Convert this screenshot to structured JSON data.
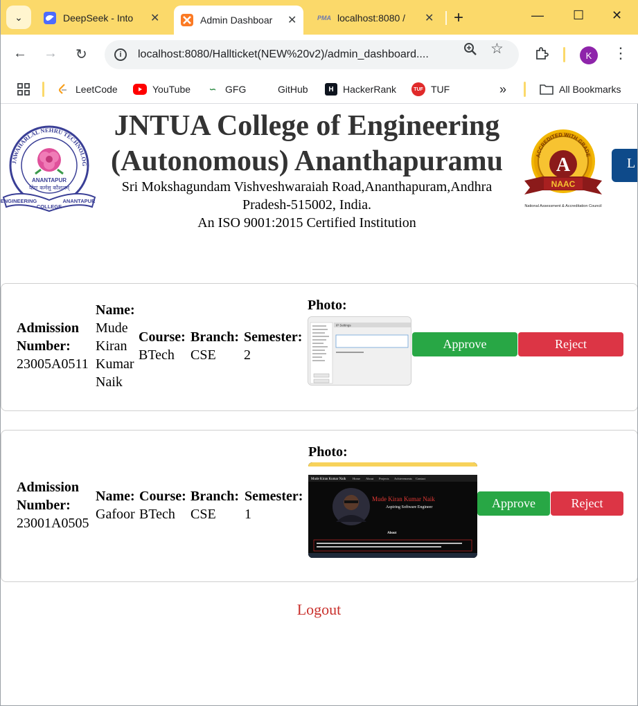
{
  "browser": {
    "tabs": [
      {
        "title": "DeepSeek - Into",
        "favicon": "deepseek-icon"
      },
      {
        "title": "Admin Dashboar",
        "favicon": "xampp-icon",
        "active": true
      },
      {
        "title": "localhost:8080 /",
        "favicon": "phpmyadmin-icon"
      }
    ],
    "url": "localhost:8080/Hallticket(NEW%20v2)/admin_dashboard....",
    "profile_initial": "K",
    "bookmarks": [
      "LeetCode",
      "YouTube",
      "GFG",
      "GitHub",
      "HackerRank",
      "TUF"
    ],
    "all_bookmarks_label": "All Bookmarks",
    "pma_label": "PMA",
    "tuf_label": "TUF"
  },
  "header": {
    "title_line1": "JNTUA College of Engineering",
    "title_line2": "(Autonomous) Ananthapuramu",
    "address_line1": "Sri Mokshagundam Vishveshwaraiah Road,Ananthapuram,Andhra",
    "address_line2": "Pradesh-515002, India.",
    "certification": "An ISO 9001:2015 Certified Institution",
    "top_button_label": "L",
    "logo_left": {
      "top_text": "JAWAHARLAL NEHRU TECHNOLOGICAL UNIVERSITY",
      "city": "ANANTAPUR",
      "hindi_motto": "योगः कर्मसु कौशलम्",
      "ribbon_left": "ENGINEERING",
      "ribbon_right": "ANANTAPUR",
      "ribbon_bottom": "COLLEGE"
    },
    "logo_right": {
      "arc_text": "ACCREDITED WITH GRADE",
      "grade": "A",
      "badge": "NAAC",
      "caption": "National Assessment & Accreditation Council"
    }
  },
  "labels": {
    "admission": "Admission Number:",
    "name": "Name:",
    "course": "Course:",
    "branch": "Branch:",
    "semester": "Semester:",
    "photo": "Photo:",
    "approve": "Approve",
    "reject": "Reject"
  },
  "students": [
    {
      "admission_number": "23005A0511",
      "name": "Mude Kiran Kumar Naik",
      "course": "BTech",
      "branch": "CSE",
      "semester": "2",
      "photo_caption": "IP Settings"
    },
    {
      "admission_number": "23001A0505",
      "name": "Gafoor",
      "course": "BTech",
      "branch": "CSE",
      "semester": "1",
      "photo_heading": "Mude Kiran Kumar Naik",
      "photo_subheading": "Aspiring Software Engineer",
      "photo_nav": [
        "Mude Kiran Kumar Naik",
        "Home",
        "About",
        "Projects",
        "Achievements",
        "Contact"
      ],
      "photo_section": "About"
    }
  ],
  "logout_label": "Logout"
}
